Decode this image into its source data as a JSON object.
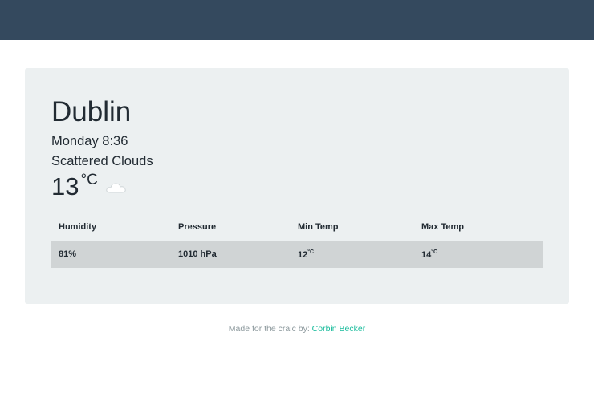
{
  "weather": {
    "city": "Dublin",
    "datetime": "Monday 8:36",
    "description": "Scattered Clouds",
    "temperature": "13",
    "temperature_unit": "°C",
    "icon": "cloud-icon"
  },
  "table": {
    "headers": [
      "Humidity",
      "Pressure",
      "Min Temp",
      "Max Temp"
    ],
    "values": {
      "humidity": "81%",
      "pressure": "1010 hPa",
      "min_temp": "12",
      "max_temp": "14",
      "unit": "°C"
    }
  },
  "footer": {
    "text": "Made for the craic by: ",
    "author_link": "Corbin Becker"
  },
  "colors": {
    "topbar": "#34495e",
    "card": "#ecf0f1",
    "row_highlight": "#d0d4d5",
    "link": "#1abc9c"
  }
}
